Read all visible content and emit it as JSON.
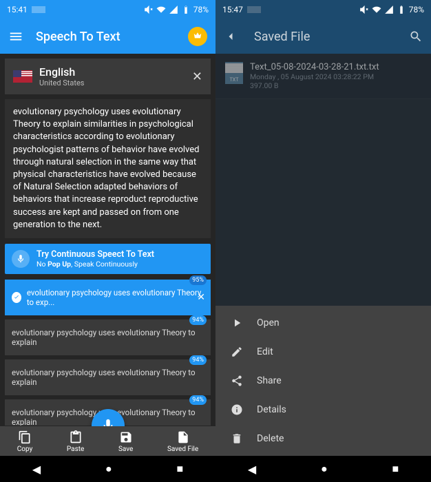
{
  "screen_a": {
    "status": {
      "time": "15:41",
      "battery": "78%"
    },
    "toolbar": {
      "title": "Speech To Text"
    },
    "language": {
      "name": "English",
      "sub": "United States"
    },
    "text": "evolutionary psychology uses evolutionary Theory to explain similarities in psychological characteristics according to evolutionary psychologist patterns of behavior have evolved through natural selection in the same way that physical characteristics have evolved because of Natural Selection adapted behaviors of behaviors that increase reproduct reproductive success are kept and passed on from one generation to the next.",
    "promo": {
      "title": "Try Continuous Speect To Text",
      "sub_pre": "No ",
      "sub_b": "Pop Up",
      "sub_post": ", Speak Continuously"
    },
    "history": [
      {
        "text": "evolutionary psychology uses evolutionary Theory to exp...",
        "pct": "95%",
        "first": true
      },
      {
        "text": "evolutionary psychology uses evolutionary Theory to explain",
        "pct": "94%"
      },
      {
        "text": "evolutionary psychology uses evolutionary Theory to explain",
        "pct": "94%"
      },
      {
        "text": "evolutionary psychology uses evolutionary Theory to explain",
        "pct": "94%"
      }
    ],
    "nav": {
      "copy": "Copy",
      "paste": "Paste",
      "save": "Save",
      "saved": "Saved File"
    }
  },
  "screen_b": {
    "status": {
      "time": "15:47",
      "battery": "78%"
    },
    "toolbar": {
      "title": "Saved File"
    },
    "file": {
      "name": "Text_05-08-2024-03-28-21.txt.txt",
      "date": "Monday , 05 August 2024 03:28:22 PM",
      "size": "397.00 B"
    },
    "menu": {
      "open": "Open",
      "edit": "Edit",
      "share": "Share",
      "details": "Details",
      "delete": "Delete"
    }
  }
}
